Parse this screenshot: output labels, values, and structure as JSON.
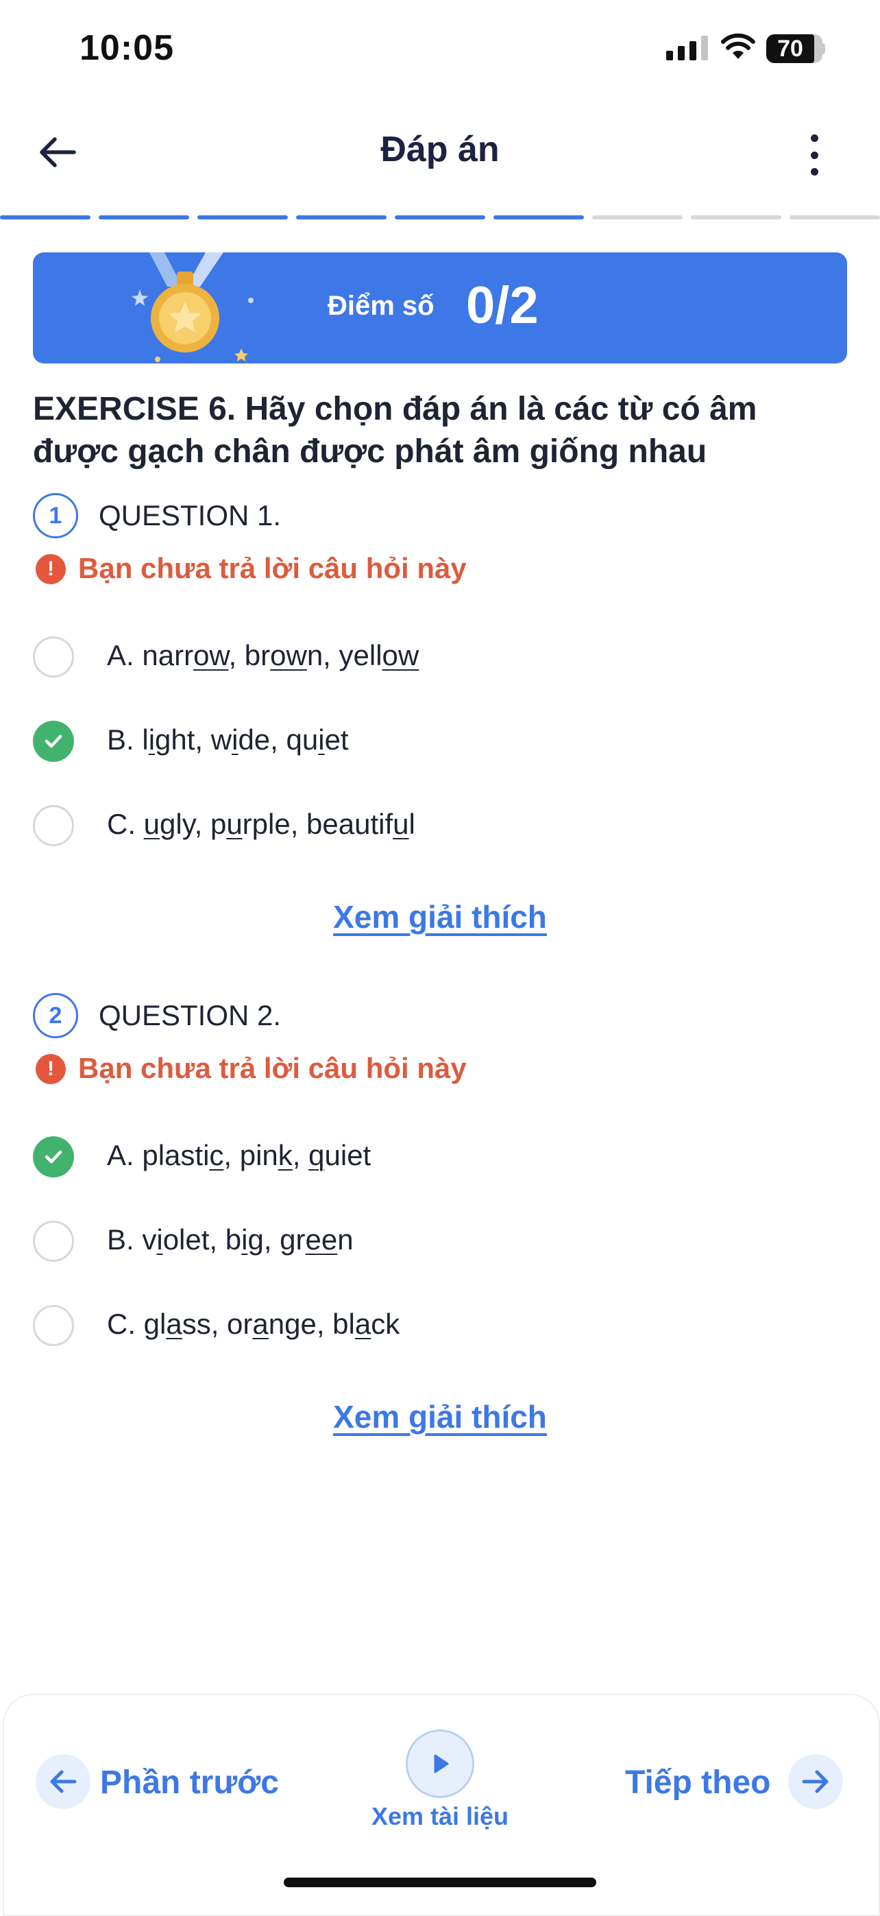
{
  "status": {
    "time": "10:05",
    "battery": "70"
  },
  "header": {
    "title": "Đáp án",
    "progress": {
      "total": 9,
      "completed": 6
    }
  },
  "score": {
    "label": "Điểm số",
    "value": "0/2"
  },
  "exercise": {
    "title": "EXERCISE 6. Hãy chọn đáp án là các từ có âm được gạch chân được phát âm giống nhau"
  },
  "questions": [
    {
      "number": "1",
      "title": "QUESTION 1.",
      "warning": "Bạn chưa trả lời câu hỏi này",
      "options": [
        {
          "label": "A. narrow, brown, yellow",
          "correct": false
        },
        {
          "label": "B. light, wide, quiet",
          "correct": true
        },
        {
          "label": "C. ugly, purple, beautiful",
          "correct": false
        }
      ],
      "explain": "Xem giải thích"
    },
    {
      "number": "2",
      "title": "QUESTION 2.",
      "warning": "Bạn chưa trả lời câu hỏi này",
      "options": [
        {
          "label": "A. plastic, pink, quiet",
          "correct": true
        },
        {
          "label": "B. violet, big, green",
          "correct": false
        },
        {
          "label": "C. glass, orange, black",
          "correct": false
        }
      ],
      "explain": "Xem giải thích"
    }
  ],
  "bottom_bar": {
    "prev": "Phần trước",
    "docs": "Xem tài liệu",
    "next": "Tiếp theo"
  },
  "colors": {
    "accent": "#3d78e6",
    "warning": "#dd5b3e",
    "correct": "#42b36f"
  }
}
